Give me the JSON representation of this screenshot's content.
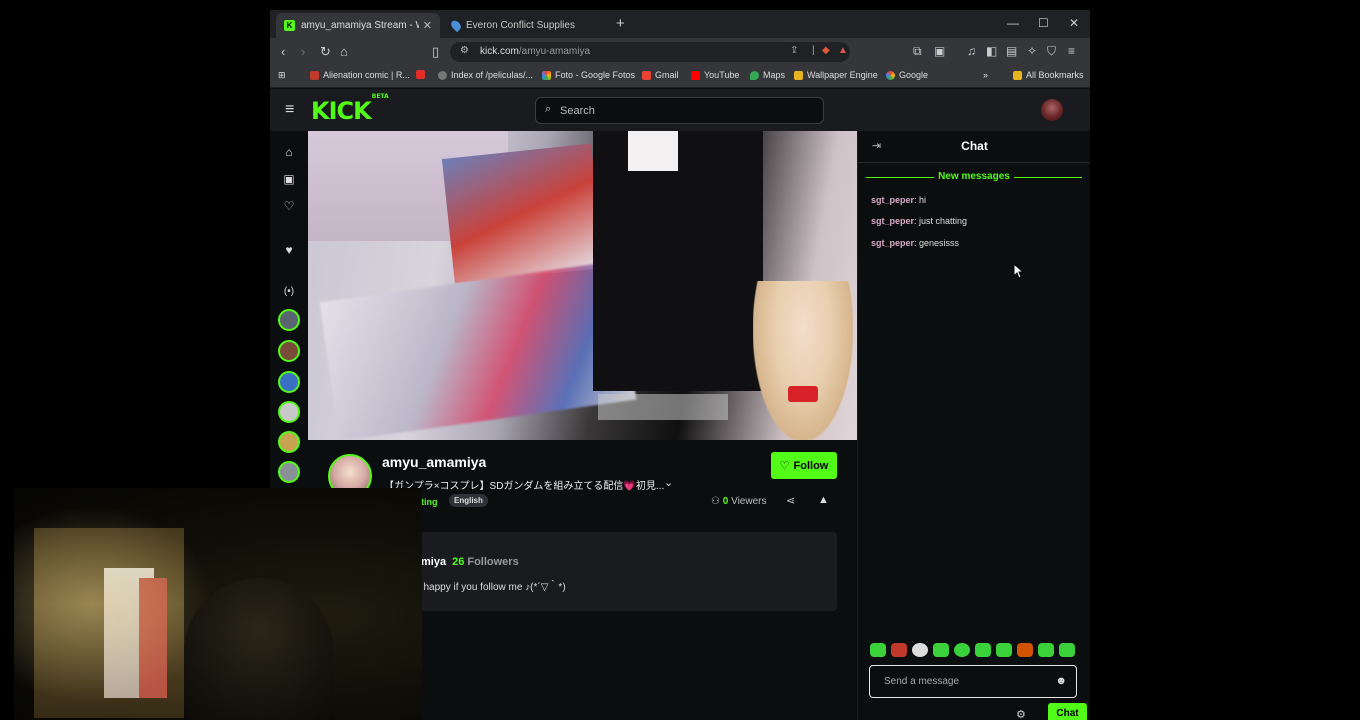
{
  "browser": {
    "tabs": [
      {
        "title": "amyu_amamiya Stream - Wat",
        "active": true
      },
      {
        "title": "Everon Conflict Supplies",
        "active": false
      }
    ],
    "url_host": "kick.com",
    "url_path": "/amyu-amamiya",
    "bookmarks": [
      "Alienation comic | R...",
      "Index of /peliculas/...",
      "Foto - Google Fotos",
      "Gmail",
      "YouTube",
      "Maps",
      "Wallpaper Engine",
      "Google"
    ],
    "all_bookmarks_label": "All Bookmarks"
  },
  "kick": {
    "logo": "KICK",
    "logo_badge": "BETA",
    "search_placeholder": "Search",
    "accent_color": "#53fc18"
  },
  "channel": {
    "name": "amyu_amamiya",
    "stream_title": "【ガンプラ×コスプレ】SDガンダムを組み立てる配信💗初見...",
    "follow_label": "Follow",
    "category_partial": "tting",
    "language": "English",
    "viewers_count": "0",
    "viewers_label": "Viewers"
  },
  "about": {
    "name_partial": "amamiya",
    "followers_count": "26",
    "followers_label": "Followers",
    "bio_partial": "ld be happy if you follow me ♪(*´▽｀*)"
  },
  "chat": {
    "title": "Chat",
    "new_messages_label": "New messages",
    "messages": [
      {
        "user": "sgt_peper",
        "text": "hi"
      },
      {
        "user": "sgt_peper",
        "text": "just chatting"
      },
      {
        "user": "sgt_peper",
        "text": "genesisss"
      }
    ],
    "input_placeholder": "Send a message",
    "send_label": "Chat"
  }
}
